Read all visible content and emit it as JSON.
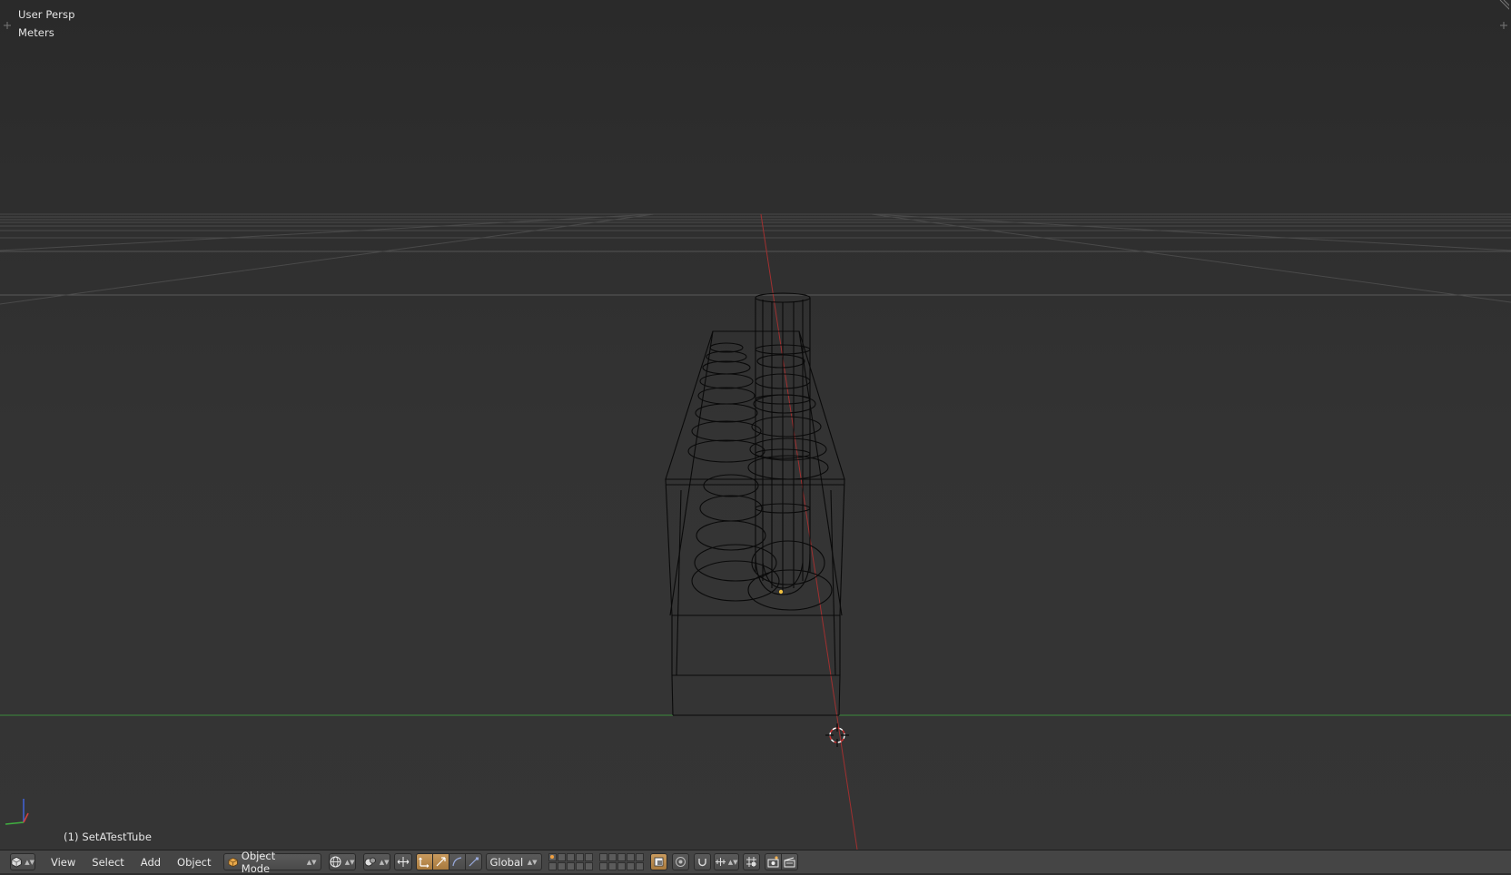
{
  "viewport": {
    "view_name": "User Persp",
    "units": "Meters",
    "active_object": "(1) SetATestTube"
  },
  "header": {
    "editor_type_icon": "3d-viewport-icon",
    "menus": [
      "View",
      "Select",
      "Add",
      "Object"
    ],
    "mode": {
      "icon": "object-mode-cube-icon",
      "label": "Object Mode"
    },
    "viewport_shading_icon": "shading-sphere-icon",
    "pivot_icon": "pivot-point-icon",
    "manipulator_icons": [
      "manipulator-toggle-icon",
      "translate-icon",
      "rotate-icon",
      "scale-icon"
    ],
    "orientation": "Global",
    "layer_count": 20,
    "active_layer": 1,
    "lock_icon": "lock-camera-layer-icon",
    "proportional_icon": "proportional-edit-icon",
    "snap_icons": [
      "snap-toggle-icon",
      "snap-element-icon"
    ],
    "render_icons": [
      "opengl-render-icon",
      "opengl-animation-icon"
    ],
    "colors": {
      "accent": "#c89a5e",
      "x_axis": "#b02828",
      "y_axis": "#3c9a3c",
      "header_bg": "#454545"
    }
  }
}
